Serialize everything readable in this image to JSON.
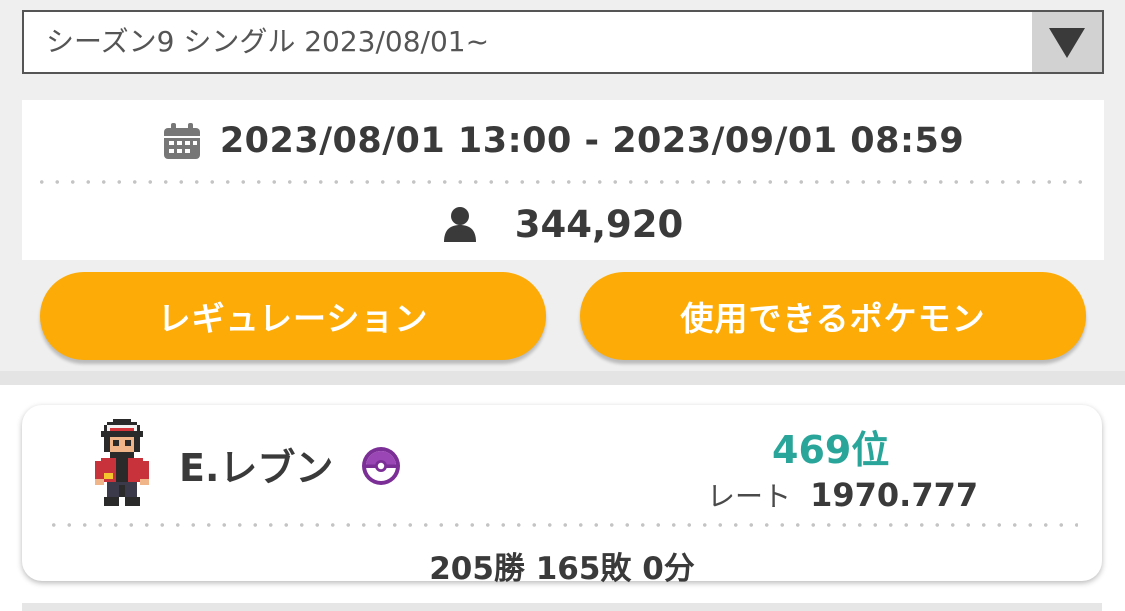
{
  "season_select": {
    "selected": "シーズン9 シングル 2023/08/01~",
    "arrow_icon": "caret-down-icon"
  },
  "season_info": {
    "period": "2023/08/01 13:00 - 2023/09/01 08:59",
    "calendar_icon": "calendar-icon",
    "player_count": "344,920",
    "person_icon": "person-icon"
  },
  "buttons": {
    "regulation": "レギュレーション",
    "usable_pokemon": "使用できるポケモン"
  },
  "player": {
    "name": "E.レブン",
    "rank": "469位",
    "rate_label": "レート",
    "rate_value": "1970.777",
    "record": "205勝 165敗 0分",
    "ball_icon": "master-ball-icon",
    "avatar": "trainer-avatar"
  },
  "colors": {
    "accent_orange": "#fcab07",
    "rank_teal": "#2aa59a",
    "ball_purple": "#7b2f96"
  }
}
